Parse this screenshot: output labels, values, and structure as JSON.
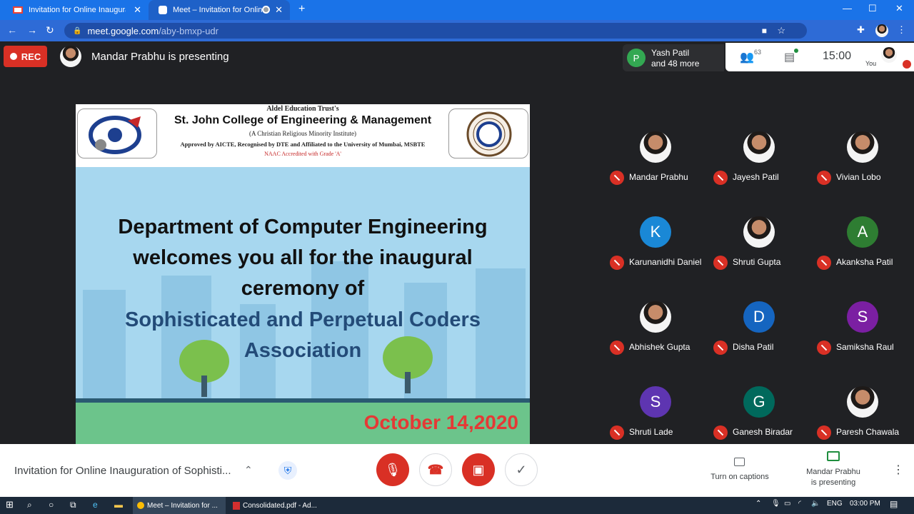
{
  "browser": {
    "tabs": [
      {
        "title": "Invitation for Online Inaugural Ce",
        "icon": "gmail-icon"
      },
      {
        "title": "Meet – Invitation for Online I",
        "icon": "meet-icon"
      }
    ],
    "url_host": "meet.google.com",
    "url_path": "/aby-bmxp-udr"
  },
  "meet": {
    "rec_label": "REC",
    "presenter_title": "Mandar Prabhu is presenting",
    "others_name": "Yash Patil",
    "others_more": "and 48 more",
    "others_initial": "P",
    "participant_count": "63",
    "time": "15:00",
    "you_label": "You"
  },
  "slide": {
    "trust": "Aldel Education Trust's",
    "college": "St. John College of Engineering & Management",
    "minority": "(A Christian Religious Minority Institute)",
    "approval": "Approved by AICTE, Recognised by DTE and Affiliated to the University of Mumbai, MSBTE",
    "naac": "NAAC Accredited with Grade 'A'",
    "line1": "Department of Computer Engineering",
    "line2": "welcomes you all for the inaugural",
    "line3": "ceremony of",
    "line4": "Sophisticated and Perpetual Coders",
    "line5": "Association",
    "date": "October 14,2020"
  },
  "participants": [
    {
      "name": "Mandar Prabhu",
      "initial": "",
      "color": ""
    },
    {
      "name": "Jayesh Patil",
      "initial": "",
      "color": ""
    },
    {
      "name": "Vivian Lobo",
      "initial": "",
      "color": ""
    },
    {
      "name": "Karunanidhi Daniel",
      "initial": "K",
      "color": "#1a88d6"
    },
    {
      "name": "Shruti Gupta",
      "initial": "",
      "color": ""
    },
    {
      "name": "Akanksha Patil",
      "initial": "A",
      "color": "#2e7d32"
    },
    {
      "name": "Abhishek Gupta",
      "initial": "",
      "color": ""
    },
    {
      "name": "Disha Patil",
      "initial": "D",
      "color": "#1565c0"
    },
    {
      "name": "Samiksha Raul",
      "initial": "S",
      "color": "#7b1fa2"
    },
    {
      "name": "Shruti Lade",
      "initial": "S",
      "color": "#5e35b1"
    },
    {
      "name": "Ganesh Biradar",
      "initial": "G",
      "color": "#00695c"
    },
    {
      "name": "Paresh Chawala",
      "initial": "",
      "color": ""
    }
  ],
  "bottom": {
    "meeting_name": "Invitation for Online Inauguration of Sophisti...",
    "captions_label": "Turn on captions",
    "presenting_line1": "Mandar Prabhu",
    "presenting_line2": "is presenting"
  },
  "taskbar": {
    "app1": "Meet – Invitation for ...",
    "app2": "Consolidated.pdf - Ad...",
    "lang": "ENG",
    "clock": "03:00 PM"
  }
}
